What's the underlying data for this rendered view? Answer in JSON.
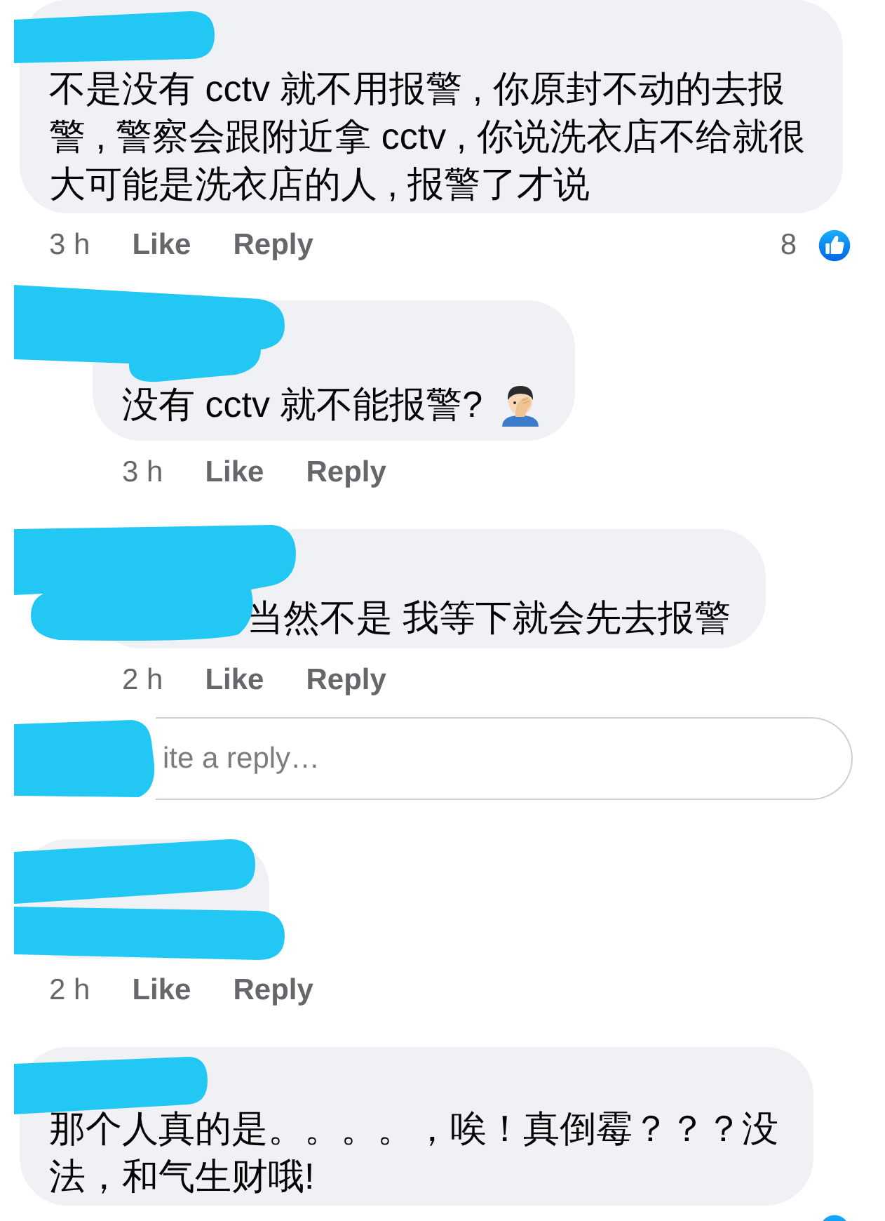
{
  "thread": [
    {
      "kind": "comment",
      "text": "不是没有 cctv 就不用报警 , 你原封不动的去报警 , 警察会跟附近拿 cctv , 你说洗衣店不给就很大可能是洗衣店的人 , 报警了才说",
      "meta": {
        "time": "3 h",
        "like": "Like",
        "reply": "Reply",
        "reaction_count": "8"
      }
    },
    {
      "kind": "reply",
      "text": "没有 cctv 就不能报警?",
      "emoji": true,
      "meta": {
        "time": "3 h",
        "like": "Like",
        "reply": "Reply"
      }
    },
    {
      "kind": "reply",
      "text": "当然不是 我等下就会先去报警",
      "meta": {
        "time": "2 h",
        "like": "Like",
        "reply": "Reply"
      }
    },
    {
      "kind": "reply_field",
      "placeholder": "ite a reply…"
    },
    {
      "kind": "comment",
      "meta": {
        "time": "2 h",
        "like": "Like",
        "reply": "Reply"
      }
    },
    {
      "kind": "comment",
      "text": "那个人真的是。。。。，唉！真倒霉？？？没法，和气生财哦!",
      "reaction_badge": true
    }
  ]
}
